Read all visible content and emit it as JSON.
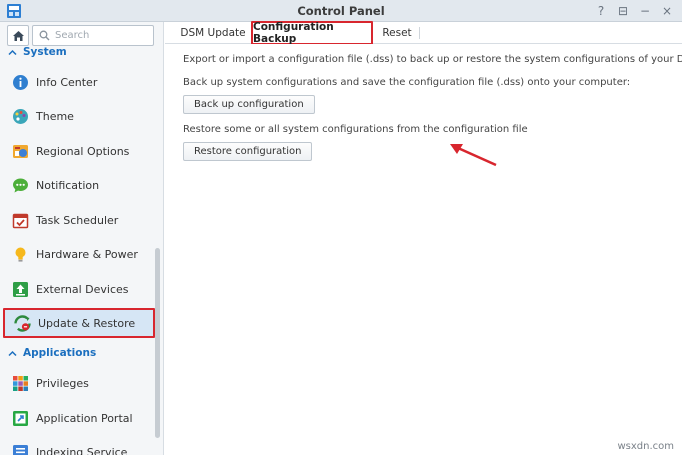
{
  "window": {
    "title": "Control Panel",
    "controls": [
      {
        "name": "help-icon",
        "glyph": "?"
      },
      {
        "name": "pin-icon",
        "glyph": "⊟"
      },
      {
        "name": "minimize-icon",
        "glyph": "−"
      },
      {
        "name": "close-icon",
        "glyph": "×"
      }
    ]
  },
  "sidebar": {
    "search_placeholder": "Search",
    "sections": [
      {
        "label": "System"
      },
      {
        "label": "Applications"
      }
    ],
    "items": [
      {
        "label": "Info Center",
        "icon": "info-icon"
      },
      {
        "label": "Theme",
        "icon": "palette-icon"
      },
      {
        "label": "Regional Options",
        "icon": "globe-icon"
      },
      {
        "label": "Notification",
        "icon": "chat-icon"
      },
      {
        "label": "Task Scheduler",
        "icon": "calendar-icon"
      },
      {
        "label": "Hardware & Power",
        "icon": "bulb-icon"
      },
      {
        "label": "External Devices",
        "icon": "upload-icon"
      },
      {
        "label": "Update & Restore",
        "icon": "restore-icon",
        "selected": true
      },
      {
        "label": "Privileges",
        "icon": "grid-icon"
      },
      {
        "label": "Application Portal",
        "icon": "portal-icon"
      },
      {
        "label": "Indexing Service",
        "icon": "index-icon"
      }
    ]
  },
  "tabs": [
    {
      "label": "DSM Update",
      "active": false
    },
    {
      "label": "Configuration Backup",
      "active": true
    },
    {
      "label": "Reset",
      "active": false
    }
  ],
  "content": {
    "intro": "Export or import a configuration file (.dss) to back up or restore the system configurations of your DSM.",
    "backup_desc": "Back up system configurations and save the configuration file (.dss) onto your computer:",
    "backup_button": "Back up configuration",
    "restore_desc": "Restore some or all system configurations from the configuration file",
    "restore_button": "Restore configuration"
  },
  "watermark": "wsxdn.com",
  "colors": {
    "accent": "#1b6fbf",
    "highlight_border": "#d8262e",
    "selected_bg": "#d6e6f5"
  }
}
